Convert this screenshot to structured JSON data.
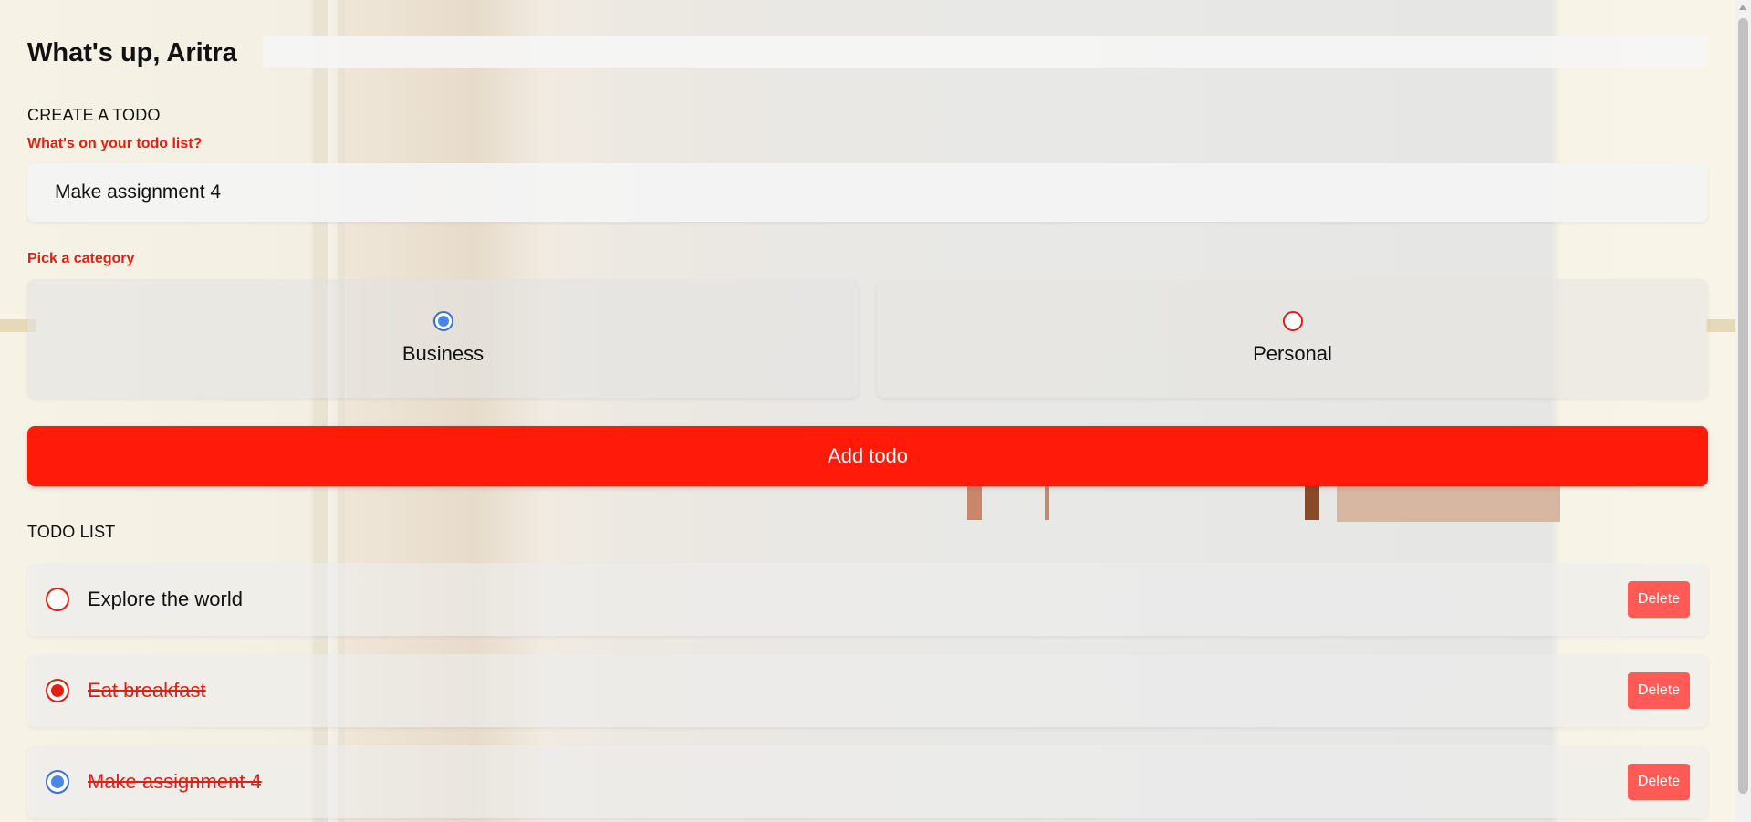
{
  "greeting": "What's up, Aritra",
  "create": {
    "section_title": "CREATE A TODO",
    "input_label": "What's on your todo list?",
    "input_value": "Make assignment 4",
    "category_label": "Pick a category",
    "categories": [
      {
        "label": "Business",
        "selected": true,
        "color": "#4a86e8"
      },
      {
        "label": "Personal",
        "selected": false,
        "color": "#e51e12"
      }
    ],
    "add_button": "Add todo"
  },
  "list": {
    "section_title": "TODO LIST",
    "items": [
      {
        "text": "Explore the world",
        "done": false,
        "category": "personal",
        "delete_label": "Delete"
      },
      {
        "text": "Eat breakfast",
        "done": true,
        "category": "personal",
        "delete_label": "Delete"
      },
      {
        "text": "Make assignment 4",
        "done": true,
        "category": "business",
        "delete_label": "Delete"
      }
    ]
  },
  "colors": {
    "accent_red": "#ff1a0a",
    "label_red": "#e51e12",
    "business_blue": "#4a86e8",
    "delete_bg": "#ff5a55"
  }
}
